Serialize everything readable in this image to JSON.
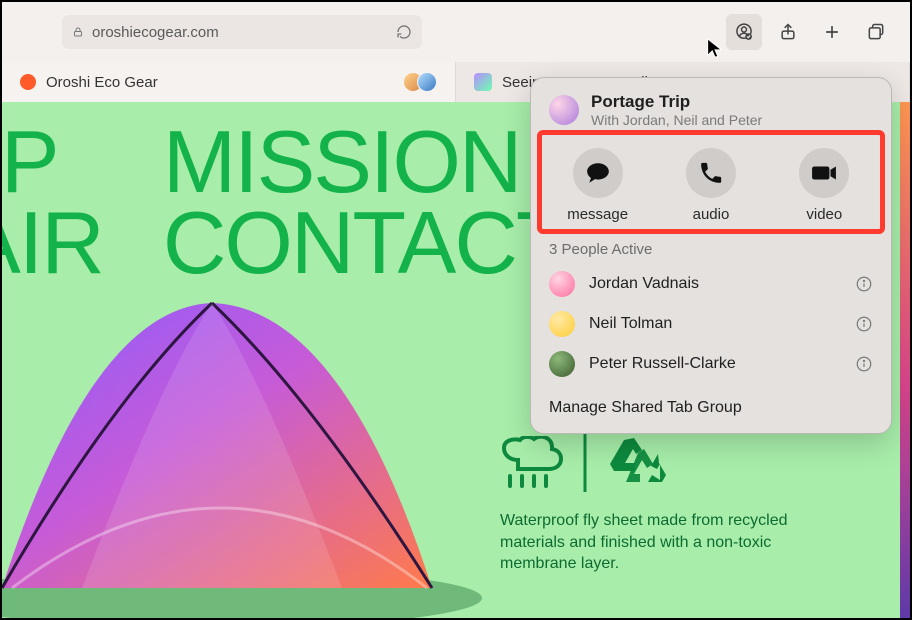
{
  "toolbar": {
    "url": "oroshiecogear.com",
    "buttons": {
      "collaborate": "collaborate",
      "share": "share",
      "new_tab": "new tab",
      "tab_overview": "tab overview"
    }
  },
  "tabs": [
    {
      "label": "Oroshi Eco Gear",
      "fav_color": "#ff5a2a",
      "shared": true
    },
    {
      "label": "Seeing Aurora Borealis"
    }
  ],
  "page": {
    "hero_left": [
      "IOP",
      "PAIR"
    ],
    "hero_right": [
      "MISSION",
      "CONTACT"
    ],
    "feature_text": "Waterproof fly sheet made from recycled materials and finished with a non-toxic membrane layer."
  },
  "popover": {
    "title": "Portage Trip",
    "subtitle": "With Jordan, Neil and Peter",
    "actions": {
      "message": "message",
      "audio": "audio",
      "video": "video"
    },
    "active_label": "3 People Active",
    "people": [
      {
        "name": "Jordan Vadnais",
        "avatar_color": "#ff6b9d"
      },
      {
        "name": "Neil Tolman",
        "avatar_color": "#ffcc33"
      },
      {
        "name": "Peter Russell-Clarke",
        "avatar_color": "#6b4a2e"
      }
    ],
    "footer": "Manage Shared Tab Group"
  }
}
